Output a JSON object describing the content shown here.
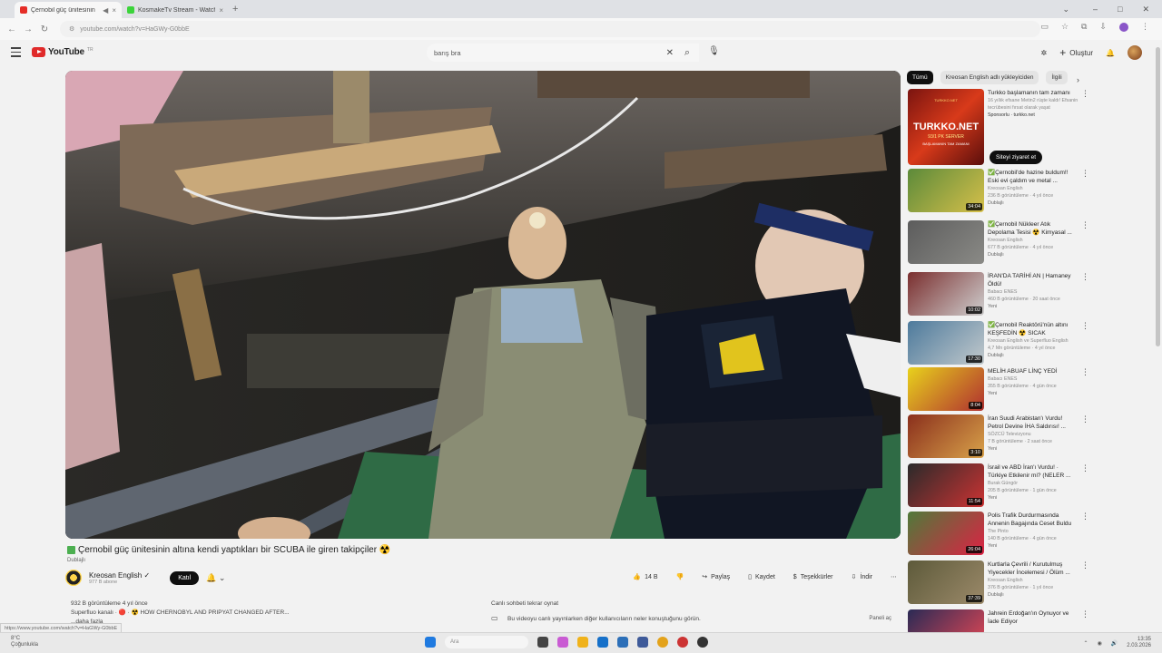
{
  "browser": {
    "tabs": [
      {
        "title": "Çernobil güç ünitesinin",
        "active": true
      },
      {
        "title": "KosmakeTv Stream - Watch Live",
        "active": false
      }
    ],
    "url": "youtube.com/watch?v=HaGWy-G0bbE"
  },
  "header": {
    "logo_text": "YouTube",
    "logo_country": "TR",
    "search_value": "barış bra",
    "create_label": "Oluştur"
  },
  "video": {
    "title": "Çernobil güç ünitesinin altına kendi yaptıkları bir SCUBA ile giren takipçiler ☢️",
    "tag": "Dublajlı",
    "channel": "Kreosan English",
    "subscribers": "977 B abone",
    "join_label": "Katıl",
    "likes": "14 B",
    "share_label": "Paylaş",
    "save_label": "Kaydet",
    "thanks_label": "Teşekkürler",
    "download_label": "İndir",
    "views_line": "932 B görüntüleme  4 yıl önce",
    "desc_line": "Superfluo kanalı · 🔴 · ☢️ HOW CHERNOBYL AND PRIPYAT CHANGED AFTER...",
    "desc_more": "...daha fazla"
  },
  "chat": {
    "replay_label": "Canlı sohbeti tekrar oynat",
    "info": "Bu videoyu canlı yayınlarken diğer kullanıcıların neler konuştuğunu görün.",
    "show_label": "Paneli aç"
  },
  "sidebar": {
    "chips": [
      "Tümü",
      "Kreosan English adlı yükleyiciden",
      "İlgili"
    ],
    "visit_label": "Siteyi ziyaret et",
    "ad": {
      "title": "Turkko başlamanın tam zamanı",
      "desc": "16 yıllık efsane Metin2 rüşte kaldı! Efsanin tecrübesini fırsat olarak yaşat",
      "sponsor": "Sponsorlu · turkko.net",
      "thumb_big": "TURKKO.NET",
      "thumb_mid": "93/1 PK SERVER",
      "thumb_small": "BAŞLAMANIN TAM ZAMANI",
      "thumb_url": "TURKKO.NET"
    },
    "items": [
      {
        "title": "✅Çernobil'de hazine buldum!! Eski evi çaldım ve metal ...",
        "channel": "Kreosan English",
        "meta": "236 B görüntüleme · 4 yıl önce",
        "badge": "Dublajlı",
        "dur": "34:04",
        "c1": "#5b8a3a",
        "c2": "#d7c04a"
      },
      {
        "title": "✅Çernobil Nükleer Atık Depolama Tesisi ☢️ Kimyasal ...",
        "channel": "Kreosan English",
        "meta": "677 B görüntüleme · 4 yıl önce",
        "badge": "Dublajlı",
        "dur": "",
        "c1": "#5c5c5c",
        "c2": "#8a8a86"
      },
      {
        "title": "İRAN'DA TARİHİ AN | Hamaney Öldü!",
        "channel": "Babacı ENES",
        "meta": "460 B görüntüleme · 20 saat önce",
        "badge": "Yeni",
        "dur": "10:02",
        "c1": "#7a2e2e",
        "c2": "#cfcfcf"
      },
      {
        "title": "✅Çernobil Reaktörü'nün altını KEŞFEDİN ☢️ SICAK PARÇALA...",
        "channel": "Kreosan English ve Superfluo English",
        "meta": "4,7 Mn görüntüleme · 4 yıl önce",
        "badge": "Dublajlı",
        "dur": "17:30",
        "c1": "#4d7a9c",
        "c2": "#c2c9cc"
      },
      {
        "title": "MELİH ABUAF LİNÇ YEDİ",
        "channel": "Babacı ENES",
        "meta": "355 B görüntüleme · 4 gün önce",
        "badge": "Yeni",
        "dur": "8:04",
        "c1": "#e8d21c",
        "c2": "#b03030"
      },
      {
        "title": "İran Suudi Arabistan'ı Vurdu! Petrol Devine İHA Saldırısı! ...",
        "channel": "SÖZCÜ Televizyonu",
        "meta": "7 B görüntüleme · 2 saat önce",
        "badge": "Yeni",
        "dur": "3:10",
        "c1": "#8a2f1c",
        "c2": "#d9a24a"
      },
      {
        "title": "İsrail ve ABD İran'ı Vurdu! · Türkiye Etkilenir mi? (NELER ...",
        "channel": "Burak Güngör",
        "meta": "205 B görüntüleme · 1 gün önce",
        "badge": "Yeni",
        "dur": "11:54",
        "c1": "#2a2a2a",
        "c2": "#c33"
      },
      {
        "title": "Polis Trafik Durdurmasında Annenin Bagajında Ceset Buldu",
        "channel": "The Pinto",
        "meta": "140 B görüntüleme · 4 gün önce",
        "badge": "Yeni",
        "dur": "26:04",
        "c1": "#4f7a3a",
        "c2": "#d24"
      },
      {
        "title": "Kurtlarla Çevrili / Kurutulmuş Yiyecekler İncelemesi / Ölüm ...",
        "channel": "Kreosan English",
        "meta": "376 B görüntüleme · 1 yıl önce",
        "badge": "Dublajlı",
        "dur": "37:39",
        "c1": "#5d5a3a",
        "c2": "#9c8a6a"
      },
      {
        "title": "Jahrein Erdoğan'ın Oynuyor ve İade Ediyor",
        "channel": "",
        "meta": "",
        "badge": "",
        "dur": "",
        "c1": "#2a2a55",
        "c2": "#c45"
      }
    ]
  },
  "taskbar": {
    "temp": "8°C",
    "weather": "Çoğunlukla",
    "search_placeholder": "Ara",
    "clock": "13:35",
    "date": "2.03.2026"
  }
}
